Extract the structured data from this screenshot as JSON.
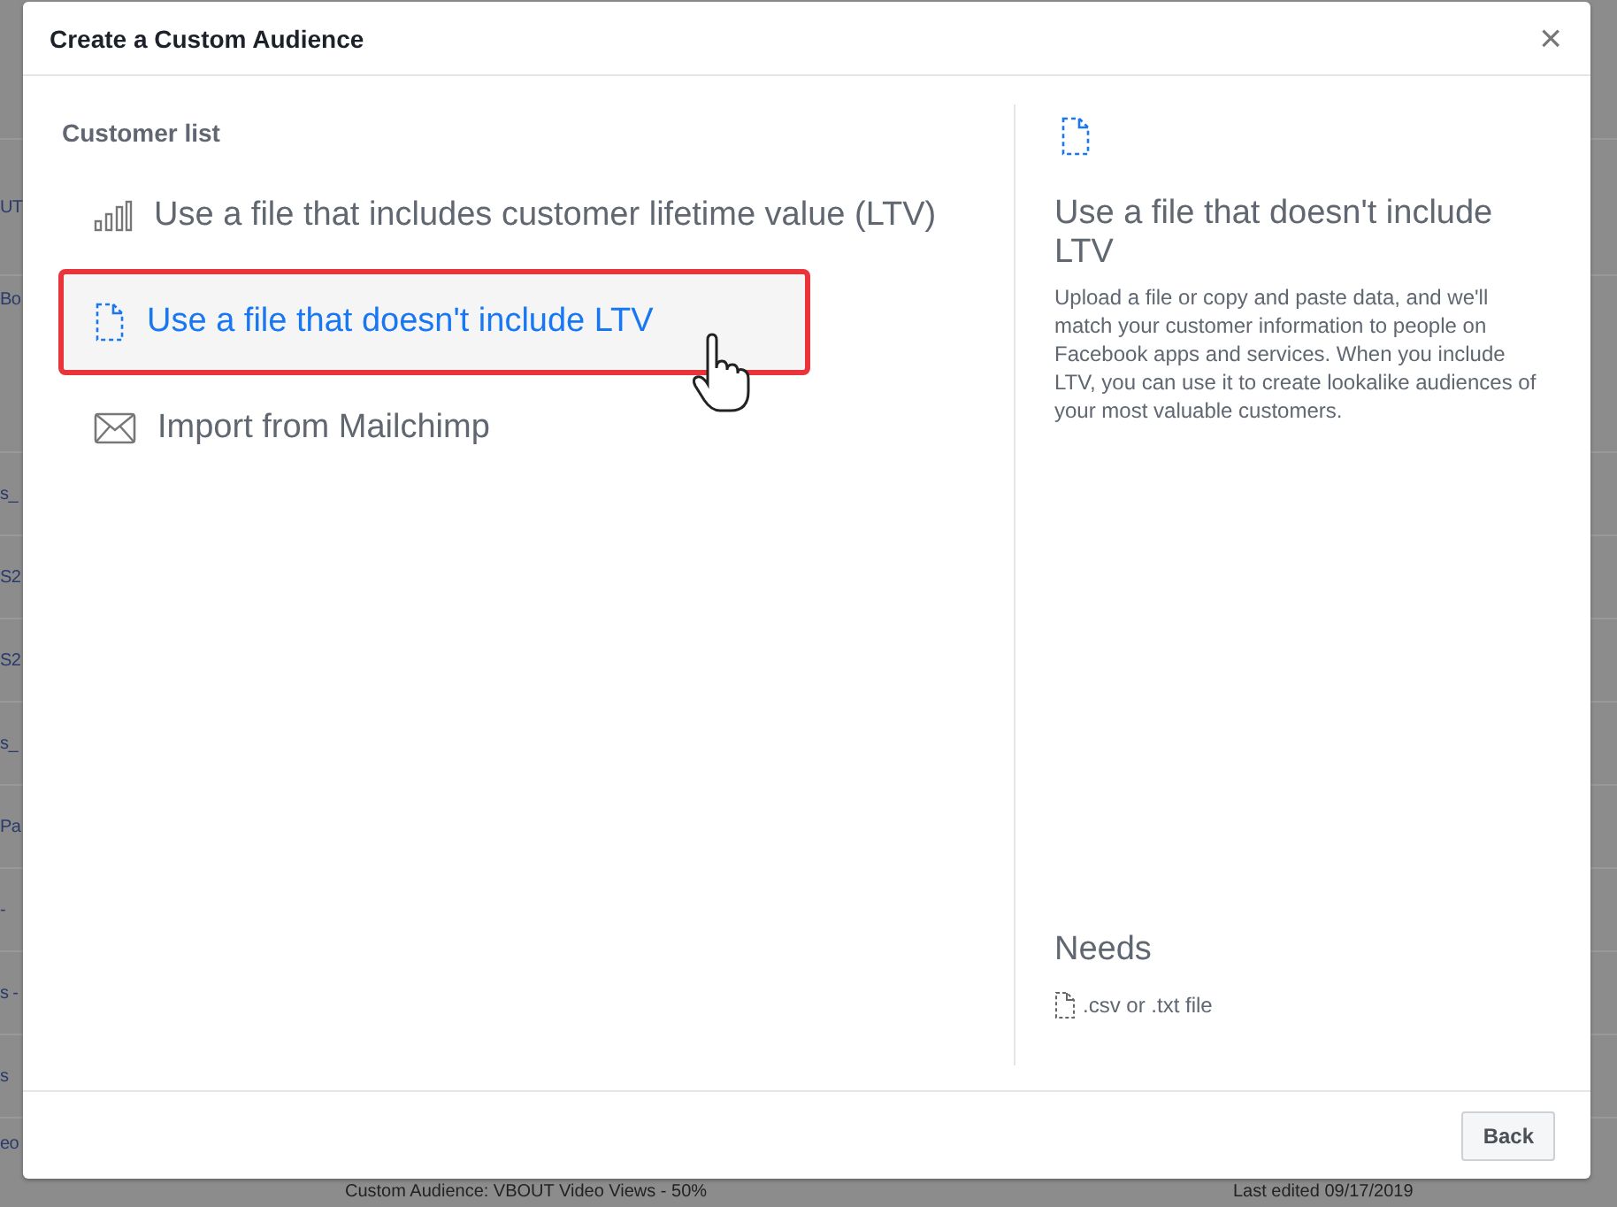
{
  "background": {
    "row_fragments": [
      "UT",
      "Bo",
      "s_",
      "S2",
      "S2",
      "s_",
      "Pa",
      "-",
      "s -",
      "s",
      "eo"
    ],
    "bottom_row": [
      "Custom Audience: VBOUT Video Views - 50%",
      "Last edited 09/17/2019"
    ]
  },
  "dialog": {
    "title": "Create a Custom Audience",
    "close": "×",
    "section_label": "Customer list",
    "options": [
      {
        "kind": "bars",
        "label": "Use a file that includes customer lifetime value (LTV)",
        "selected": false,
        "highlighted": false
      },
      {
        "kind": "file",
        "label": "Use a file that doesn't include LTV",
        "selected": true,
        "highlighted": true
      },
      {
        "kind": "mail",
        "label": "Import from Mailchimp",
        "selected": false,
        "highlighted": false
      }
    ],
    "detail": {
      "title": "Use a file that doesn't include LTV",
      "description": "Upload a file or copy and paste data, and we'll match your customer information to people on Facebook apps and services. When you include LTV, you can use it to create lookalike audiences of your most valuable customers.",
      "needs_title": "Needs",
      "needs_item": ".csv or .txt file"
    },
    "buttons": [
      "Back"
    ]
  }
}
